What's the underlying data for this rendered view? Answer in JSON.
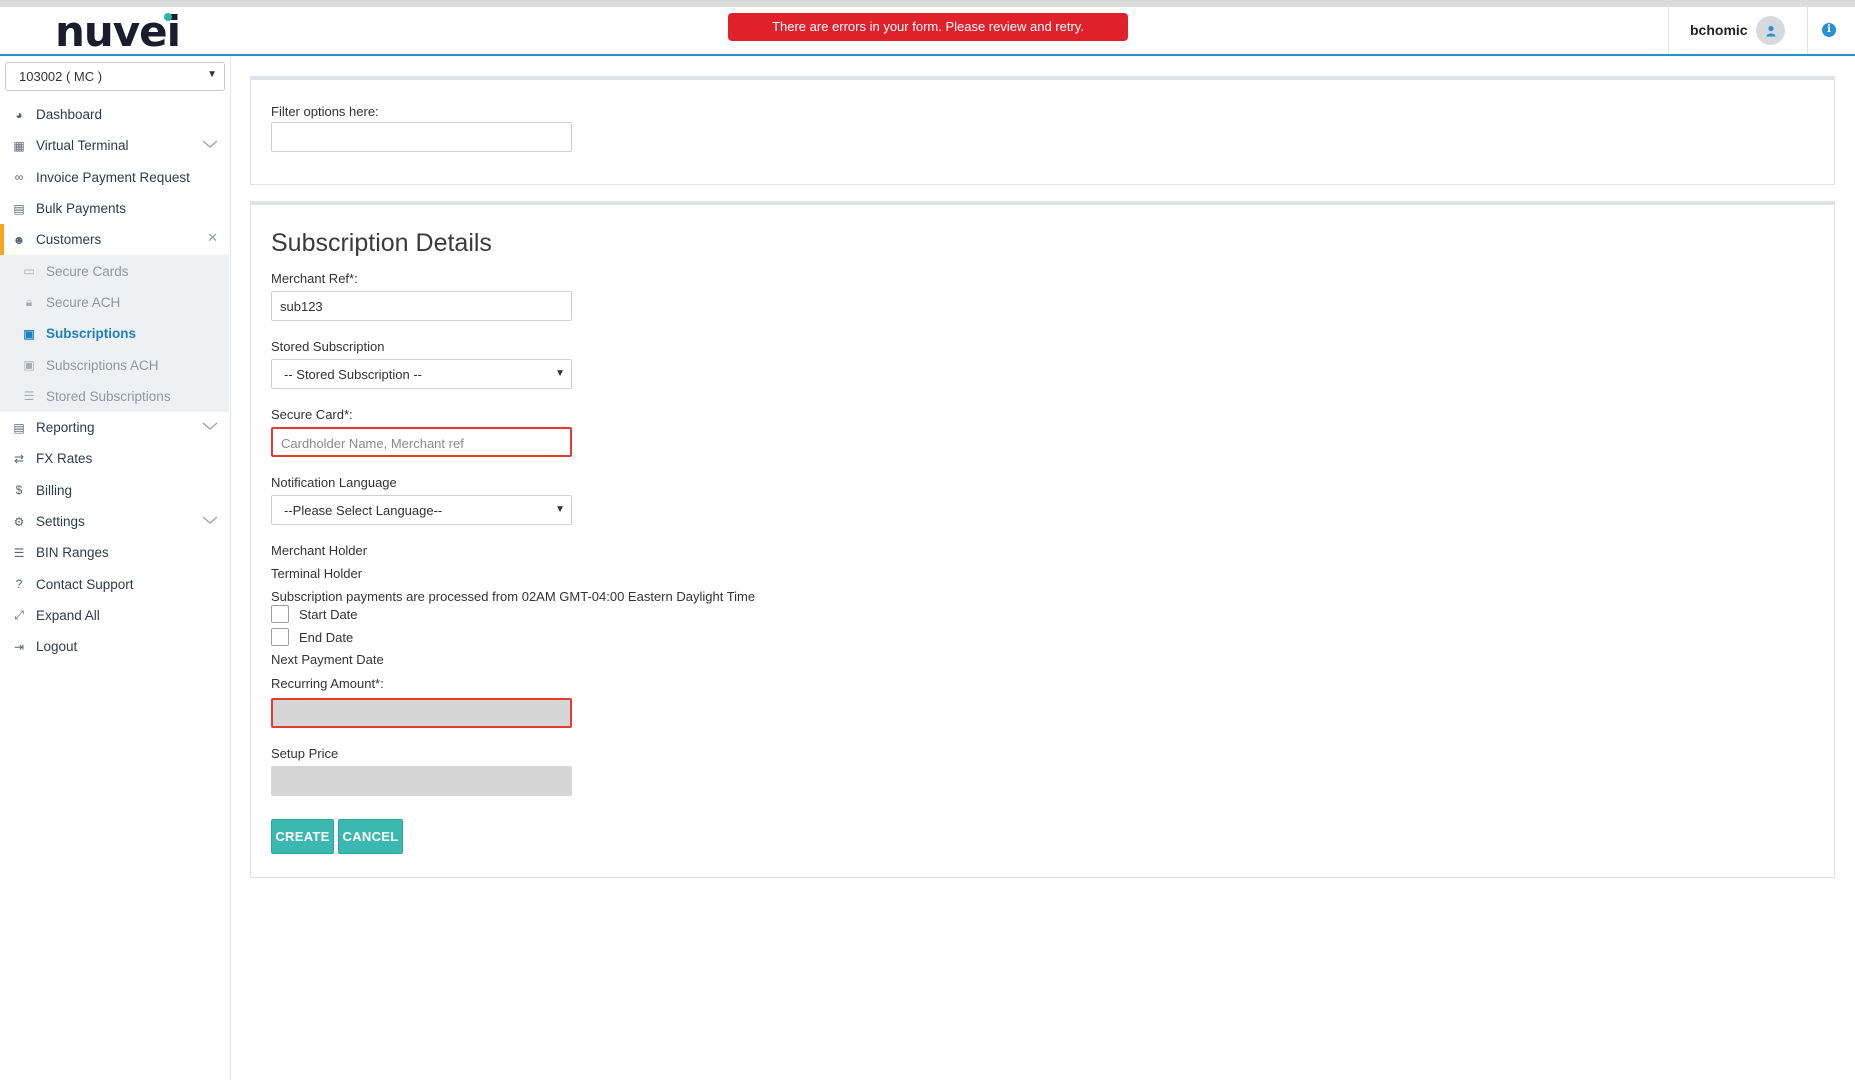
{
  "header": {
    "logo": "nuvei",
    "error_message": "There are errors in your form. Please review and retry.",
    "username": "bchomic"
  },
  "sidebar": {
    "merchant_selected": "103002 ( MC )",
    "items": [
      {
        "label": "Dashboard",
        "icon": "dashboard-icon"
      },
      {
        "label": "Virtual Terminal",
        "icon": "calculator-icon"
      },
      {
        "label": "Invoice Payment Request",
        "icon": "link-icon"
      },
      {
        "label": "Bulk Payments",
        "icon": "file-icon"
      },
      {
        "label": "Customers",
        "icon": "users-icon"
      }
    ],
    "customers_sub": [
      {
        "label": "Secure Cards",
        "icon": "credit-card-icon"
      },
      {
        "label": "Secure ACH",
        "icon": "lock-icon"
      },
      {
        "label": "Subscriptions",
        "icon": "subscription-icon"
      },
      {
        "label": "Subscriptions ACH",
        "icon": "subscription-ach-icon"
      },
      {
        "label": "Stored Subscriptions",
        "icon": "database-icon"
      }
    ],
    "items_after": [
      {
        "label": "Reporting",
        "icon": "report-icon"
      },
      {
        "label": "FX Rates",
        "icon": "exchange-icon"
      },
      {
        "label": "Billing",
        "icon": "dollar-icon"
      },
      {
        "label": "Settings",
        "icon": "gears-icon"
      },
      {
        "label": "BIN Ranges",
        "icon": "list-icon"
      },
      {
        "label": "Contact Support",
        "icon": "question-icon"
      },
      {
        "label": "Expand All",
        "icon": "expand-icon"
      },
      {
        "label": "Logout",
        "icon": "logout-icon"
      }
    ]
  },
  "filter": {
    "label": "Filter options here:",
    "value": ""
  },
  "form": {
    "title": "Subscription Details",
    "merchant_ref_label": "Merchant Ref*:",
    "merchant_ref_value": "sub123",
    "stored_subscription_label": "Stored Subscription",
    "stored_subscription_selected": "-- Stored Subscription --",
    "secure_card_label": "Secure Card*:",
    "secure_card_placeholder": "Cardholder Name, Merchant ref",
    "notification_language_label": "Notification Language",
    "notification_language_selected": "--Please Select Language--",
    "merchant_holder": "Merchant Holder",
    "terminal_holder": "Terminal Holder",
    "processing_note": "Subscription payments are processed from 02AM GMT-04:00 Eastern Daylight Time",
    "start_date_label": "Start Date",
    "end_date_label": "End Date",
    "next_payment_date": "Next Payment Date",
    "recurring_amount_label": "Recurring Amount*:",
    "setup_price_label": "Setup Price",
    "create_label": "CREATE",
    "cancel_label": "CANCEL"
  },
  "colors": {
    "accent": "#3bb9b1",
    "error": "#e0202a",
    "active_link": "#1d7fc4",
    "header_rule": "#2a8fd0"
  }
}
